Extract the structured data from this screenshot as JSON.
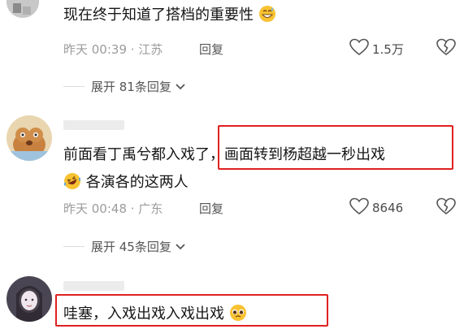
{
  "comments": [
    {
      "text": "现在终于知道了搭档的重要性",
      "emoji": "grinning-sweat-emoji",
      "meta": "昨天 00:39 · 江苏",
      "reply_label": "回复",
      "likes": "1.5万",
      "expand_label": "展开 81条回复"
    },
    {
      "text_line1_a": "前面看丁禹兮都入戏",
      "text_line1_b": "了，画面转到杨超越一秒出戏",
      "text_line2": "各演各的这两人",
      "emoji": "rolling-laughing-emoji",
      "meta": "昨天 00:48 · 广东",
      "reply_label": "回复",
      "likes": "8646",
      "expand_label": "展开 45条回复"
    },
    {
      "text": "哇塞，入戏出戏入戏出戏",
      "emoji": "pleading-face-emoji"
    }
  ],
  "colors": {
    "highlight": "#e02020",
    "meta_text": "#9b9b9b"
  }
}
